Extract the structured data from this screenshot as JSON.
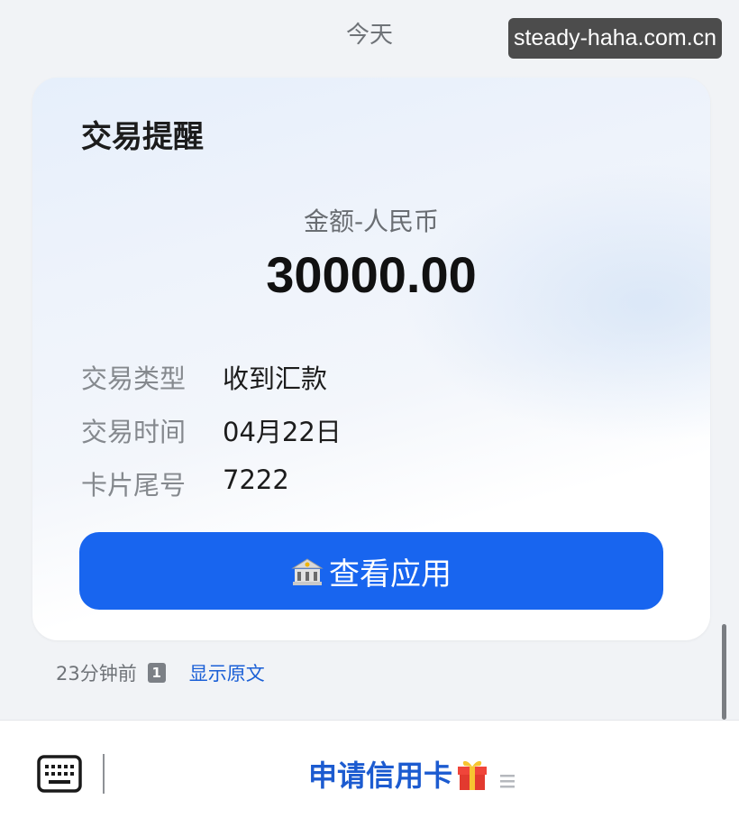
{
  "header": {
    "date_label": "今天",
    "watermark": "steady-haha.com.cn"
  },
  "card": {
    "title": "交易提醒",
    "amount_label": "金额-人民币",
    "amount_value": "30000.00",
    "details": [
      {
        "key": "交易类型",
        "value": "收到汇款"
      },
      {
        "key": "交易时间",
        "value": "04月22日"
      },
      {
        "key": "卡片尾号",
        "value": "7222"
      }
    ],
    "button_label": "查看应用",
    "button_icon": "bank-building-icon",
    "button_color": "#1865ef"
  },
  "meta": {
    "time_ago": "23分钟前",
    "sim_slot": "1",
    "show_original": "显示原文"
  },
  "bottom_bar": {
    "menu_label": "申请信用卡",
    "menu_icon": "gift-icon",
    "keyboard_icon": "keyboard-icon",
    "menu_lines_icon": "menu-lines-icon"
  }
}
